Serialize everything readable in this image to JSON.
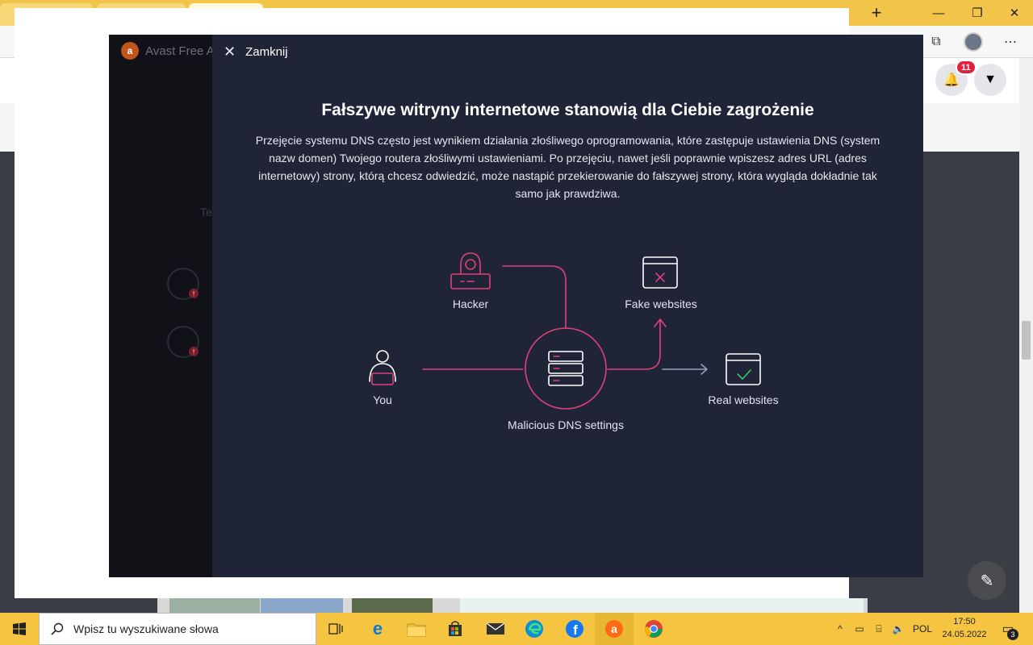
{
  "browser": {
    "notification_count": "11"
  },
  "avast": {
    "app_title": "Avast Free A",
    "ghost_text": "Te"
  },
  "modal": {
    "close_label": "Zamknij",
    "title": "Fałszywe witryny internetowe stanowią dla Ciebie zagrożenie",
    "description": "Przejęcie systemu DNS często jest wynikiem działania złośliwego oprogramowania, które zastępuje ustawienia DNS (system nazw domen) Twojego routera złośliwymi ustawieniami. Po przejęciu, nawet jeśli poprawnie wpiszesz adres URL (adres internetowy) strony, którą chcesz odwiedzić, może nastąpić przekierowanie do fałszywej strony, która wygląda dokładnie tak samo jak prawdziwa.",
    "diagram": {
      "hacker_label": "Hacker",
      "you_label": "You",
      "dns_label": "Malicious DNS settings",
      "fake_label": "Fake websites",
      "real_label": "Real websites"
    },
    "colors": {
      "background": "#1f2437",
      "accent": "#e0407a",
      "safe": "#3cc46a"
    }
  },
  "taskbar": {
    "search_placeholder": "Wpisz tu wyszukiwane słowa",
    "language": "POL",
    "time": "17:50",
    "date": "24.05.2022",
    "notification_count": "3"
  }
}
